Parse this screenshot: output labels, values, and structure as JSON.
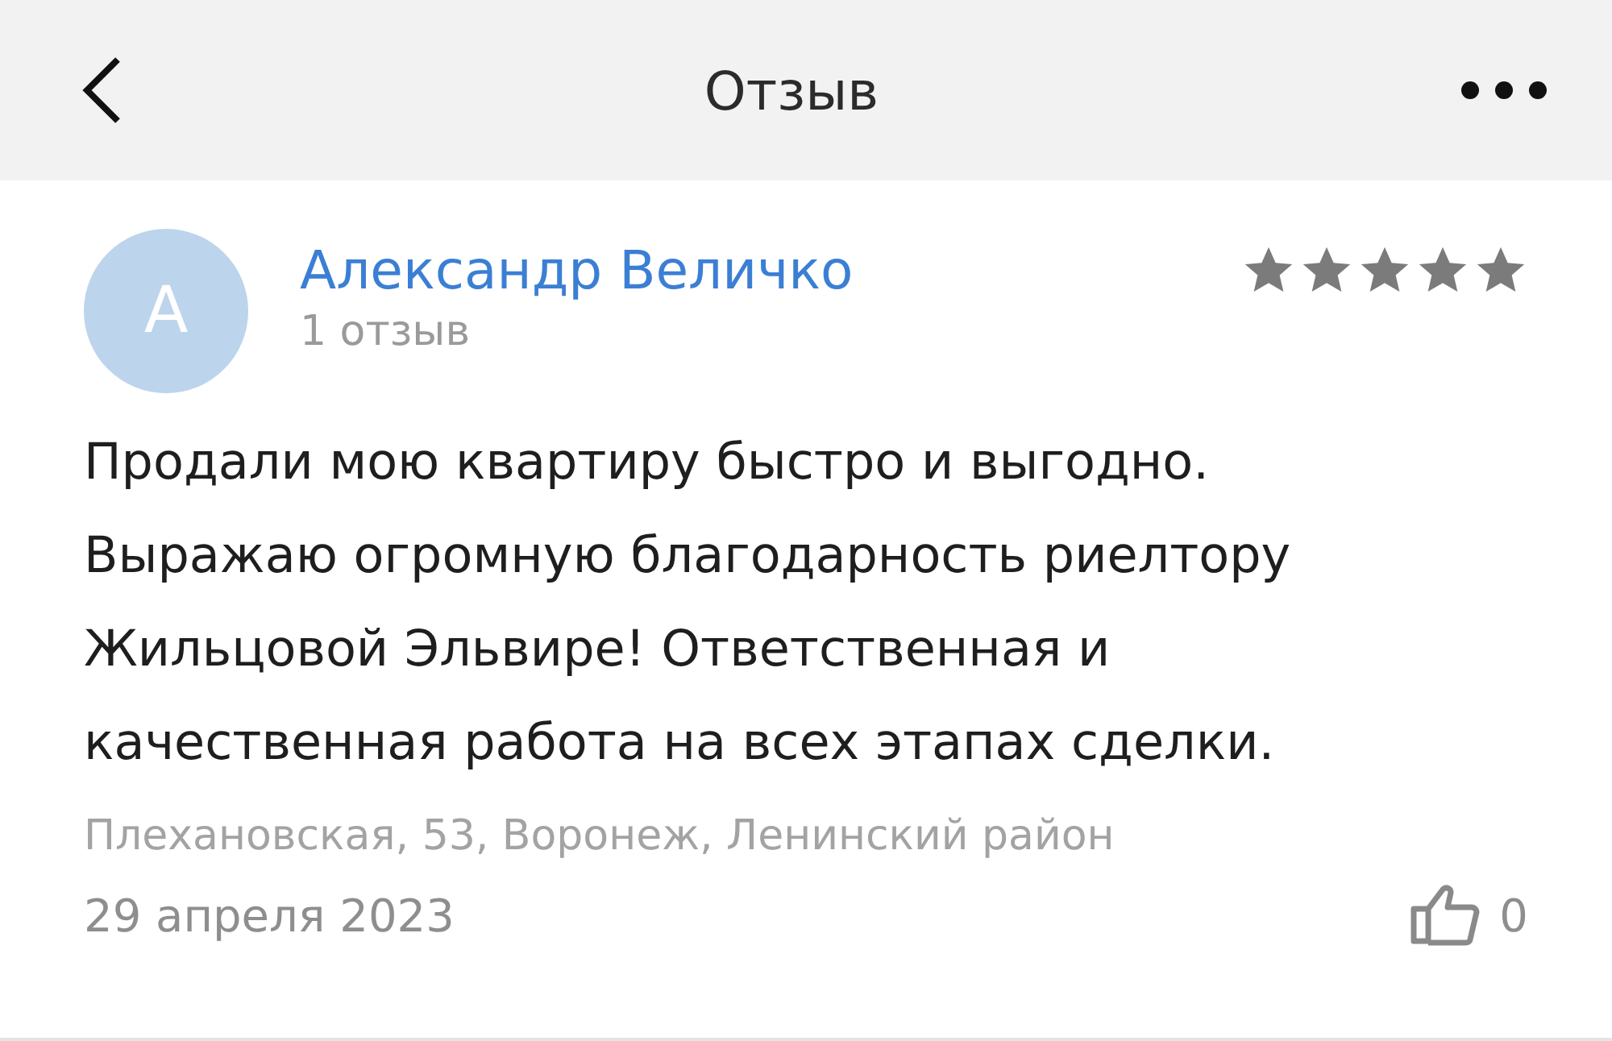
{
  "header": {
    "title": "Отзыв"
  },
  "review": {
    "avatar_letter": "А",
    "author": "Александр Величко",
    "author_reviews": "1 отзыв",
    "stars": 5,
    "text": "Продали мою квартиру быстро и выгодно. Выражаю огромную благодарность риелтору Жильцовой Эльвире! Ответственная и качественная работа на всех этапах сделки.",
    "address": "Плехановская, 53, Воронеж, Ленинский район",
    "date": "29 апреля 2023",
    "likes": "0"
  }
}
